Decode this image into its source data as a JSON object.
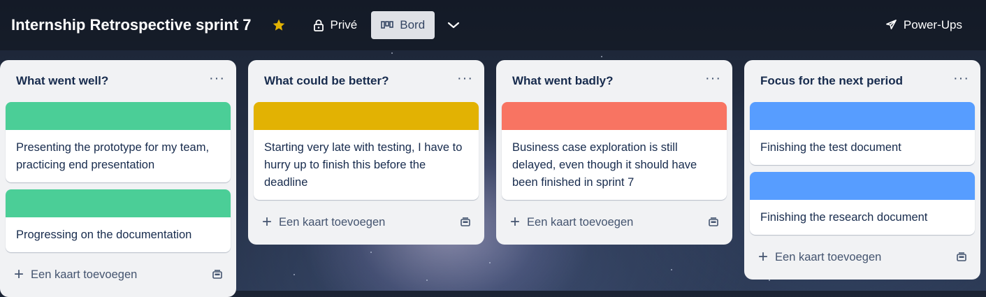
{
  "board": {
    "title": "Internship Retrospective sprint 7",
    "visibility": "Privé",
    "view": "Bord",
    "power_ups": "Power-Ups"
  },
  "lists": [
    {
      "title": "What went well?",
      "cover_color": "#4bce97",
      "cards": [
        "Presenting the prototype for my team, practicing end presentation",
        "Progressing on the documentation"
      ],
      "add_label": "Een kaart toevoegen"
    },
    {
      "title": "What could be better?",
      "cover_color": "#e2b203",
      "cards": [
        "Starting very late with testing, I have to hurry up to finish this before the deadline"
      ],
      "add_label": "Een kaart toevoegen"
    },
    {
      "title": "What went badly?",
      "cover_color": "#f87462",
      "cards": [
        "Business case exploration is still delayed, even though it should have been finished in sprint 7"
      ],
      "add_label": "Een kaart toevoegen"
    },
    {
      "title": "Focus for the next period",
      "cover_color": "#579dff",
      "cards": [
        "Finishing the test document",
        "Finishing the research document"
      ],
      "add_label": "Een kaart toevoegen"
    }
  ],
  "icons": {
    "star": "star-icon",
    "visibility": "lock-icon",
    "view": "board-icon",
    "chevron": "chevron-down-icon",
    "power_ups": "rocket-icon",
    "menu": "more-icon",
    "add": "plus-icon",
    "template": "card-template-icon"
  },
  "colors": {
    "star": "#e2b203",
    "list_bg": "#f1f2f4",
    "text": "#172b4d"
  }
}
